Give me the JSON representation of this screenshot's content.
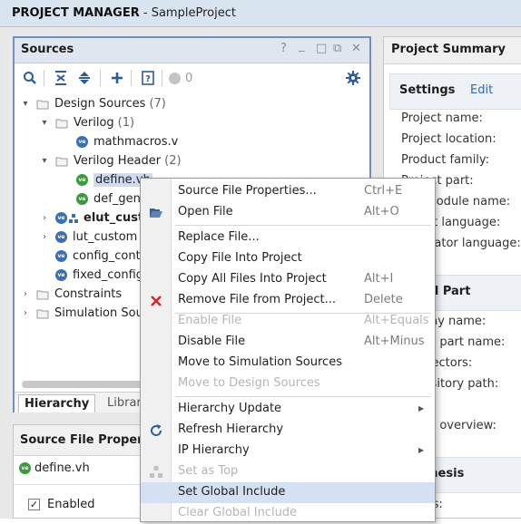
{
  "title_bar": {
    "app": "PROJECT MANAGER",
    "separator": " - ",
    "project": "SampleProject"
  },
  "sources_panel": {
    "title": "Sources",
    "window_controls": [
      "?",
      "_",
      "□",
      "⧉",
      "✕"
    ],
    "toolbar": {
      "counter": "0"
    },
    "tabs": [
      "Hierarchy",
      "Librari"
    ]
  },
  "tree": {
    "design_sources": {
      "label": "Design Sources",
      "count": "(7)"
    },
    "verilog": {
      "label": "Verilog",
      "count": "(1)"
    },
    "mathmacros": "mathmacros.v",
    "verilog_header": {
      "label": "Verilog Header",
      "count": "(2)"
    },
    "define": "define.vh",
    "def_gen": "def_gen",
    "elut": "elut_cust",
    "lut": "lut_custom",
    "config": "config_cont",
    "fixed": "fixed_config",
    "constraints": "Constraints",
    "sim_sources": "Simulation Sour"
  },
  "props_panel": {
    "title": "Source File Proper",
    "file": "define.vh",
    "enabled": "Enabled"
  },
  "summary_panel": {
    "title": "Project Summary",
    "settings": "Settings",
    "edit": "Edit",
    "settings_lines": [
      "Project name:",
      "Project location:",
      "Product family:",
      "Project part:",
      "Top module name:",
      "Target language:",
      "Simulator language:"
    ],
    "part_section": "Board Part",
    "part_lines": [
      "Display name:",
      "Board part name:",
      "Connectors:",
      "Repository path:",
      "",
      "Board overview:"
    ],
    "synthesis": "Synthesis",
    "synthesis_lines": [
      "Status:"
    ]
  },
  "context_menu": {
    "items": [
      {
        "label": "Source File Properties...",
        "shortcut": "Ctrl+E"
      },
      {
        "label": "Open File",
        "shortcut": "Alt+O"
      },
      {
        "label": "Replace File...",
        "shortcut": ""
      },
      {
        "label": "Copy File Into Project",
        "shortcut": ""
      },
      {
        "label": "Copy All Files Into Project",
        "shortcut": "Alt+I"
      },
      {
        "label": "Remove File from Project...",
        "shortcut": "Delete"
      },
      {
        "label": "Enable File",
        "shortcut": "Alt+Equals"
      },
      {
        "label": "Disable File",
        "shortcut": "Alt+Minus"
      },
      {
        "label": "Move to Simulation Sources",
        "shortcut": ""
      },
      {
        "label": "Move to Design Sources",
        "shortcut": ""
      },
      {
        "label": "Hierarchy Update",
        "shortcut": ""
      },
      {
        "label": "Refresh Hierarchy",
        "shortcut": ""
      },
      {
        "label": "IP Hierarchy",
        "shortcut": ""
      },
      {
        "label": "Set as Top",
        "shortcut": ""
      },
      {
        "label": "Set Global Include",
        "shortcut": ""
      },
      {
        "label": "Clear Global Include",
        "shortcut": ""
      }
    ]
  },
  "colors": {
    "accent": "#2f67b2",
    "highlight": "#d4e1f3",
    "panel_border": "#6e8fbf",
    "remove_icon": "#d62828",
    "verilog_blue": "#3a6fb8",
    "verilog_green": "#3c9a3c"
  }
}
